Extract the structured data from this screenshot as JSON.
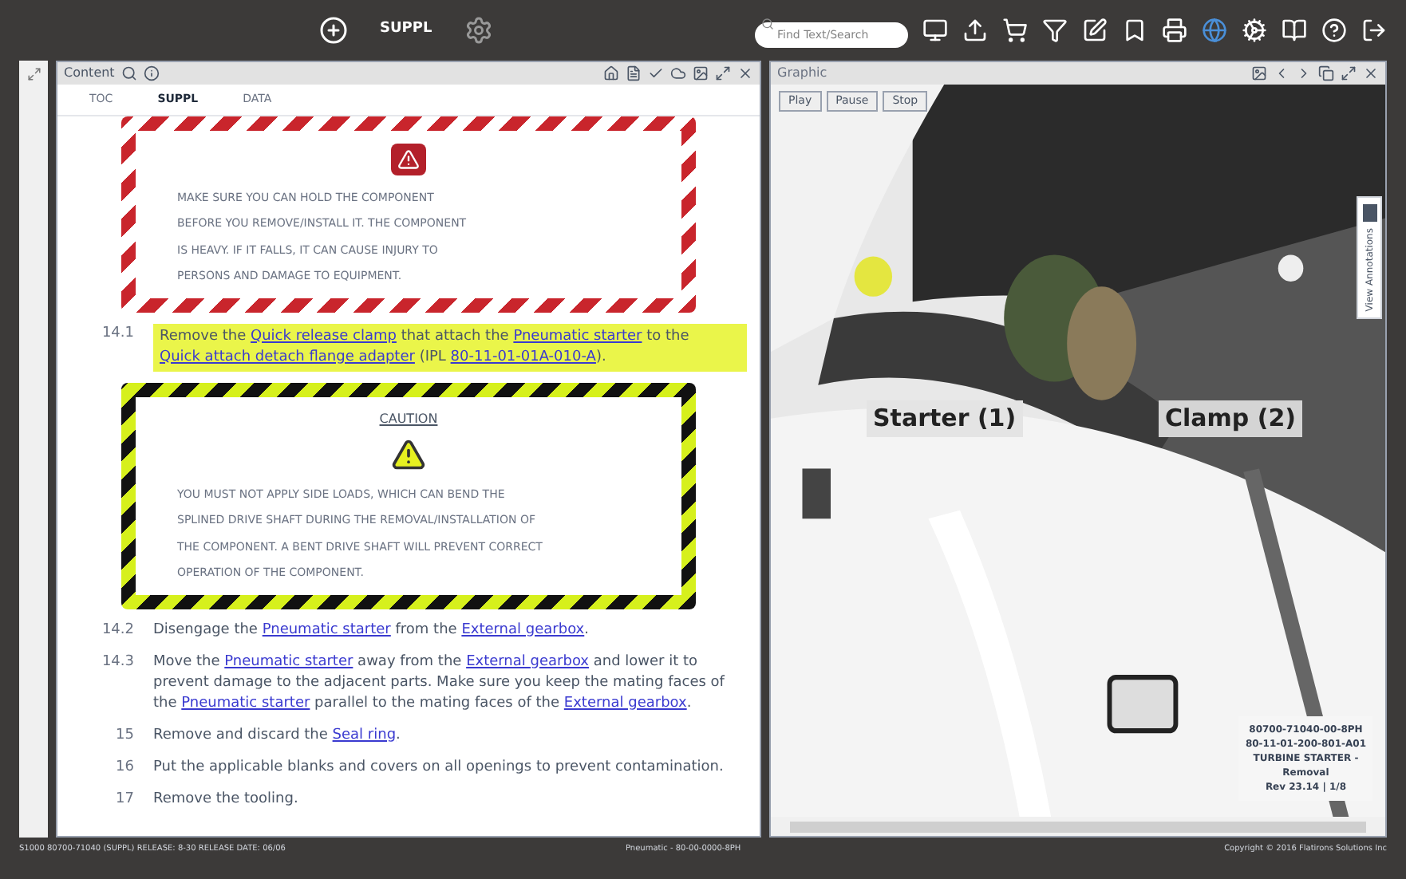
{
  "topbar": {
    "publication": "SUPPL",
    "search": {
      "placeholder": "Find Text/Search"
    }
  },
  "content_panel": {
    "title": "Content",
    "tabs": [
      {
        "label": "TOC",
        "selected": false
      },
      {
        "label": "SUPPL",
        "selected": true
      },
      {
        "label": "DATA",
        "selected": false
      }
    ],
    "warning": {
      "kind": "warning",
      "lines": [
        "MAKE SURE YOU CAN HOLD THE COMPONENT",
        "BEFORE YOU REMOVE/INSTALL IT. THE COMPONENT",
        "IS HEAVY. IF IT FALLS, IT CAN CAUSE INJURY TO",
        "PERSONS AND DAMAGE TO EQUIPMENT."
      ]
    },
    "step_14_1": {
      "number": "14.1",
      "highlighted": true,
      "parts": [
        {
          "text": "Remove the ",
          "link": false
        },
        {
          "text": "Quick release clamp",
          "link": true
        },
        {
          "text": " that attach the ",
          "link": false
        },
        {
          "text": "Pneumatic starter",
          "link": true
        },
        {
          "text": " to the ",
          "link": false
        },
        {
          "text": "Quick attach detach flange adapter",
          "link": true
        },
        {
          "text": " (IPL ",
          "link": false
        },
        {
          "text": "80-11-01-01A-010-A",
          "link": true
        },
        {
          "text": ").",
          "link": false
        }
      ]
    },
    "caution": {
      "kind": "caution",
      "title": "CAUTION",
      "lines": [
        "YOU MUST NOT APPLY SIDE LOADS, WHICH CAN BEND THE",
        "SPLINED DRIVE SHAFT DURING THE REMOVAL/INSTALLATION OF",
        "THE COMPONENT. A BENT DRIVE SHAFT WILL PREVENT CORRECT",
        "OPERATION OF THE COMPONENT."
      ]
    },
    "steps": [
      {
        "number": "14.2",
        "highlighted": false,
        "parts": [
          {
            "text": "Disengage the ",
            "link": false
          },
          {
            "text": "Pneumatic starter",
            "link": true
          },
          {
            "text": " from the ",
            "link": false
          },
          {
            "text": "External gearbox",
            "link": true
          },
          {
            "text": ".",
            "link": false
          }
        ]
      },
      {
        "number": "14.3",
        "highlighted": false,
        "parts": [
          {
            "text": "Move the ",
            "link": false
          },
          {
            "text": "Pneumatic starter",
            "link": true
          },
          {
            "text": " away from the ",
            "link": false
          },
          {
            "text": "External gearbox",
            "link": true
          },
          {
            "text": " and lower it to prevent damage to the adjacent parts. Make sure you keep the mating faces of the ",
            "link": false
          },
          {
            "text": "Pneumatic starter",
            "link": true
          },
          {
            "text": " parallel to the mating faces of the ",
            "link": false
          },
          {
            "text": "External gearbox",
            "link": true
          },
          {
            "text": ".",
            "link": false
          }
        ]
      },
      {
        "number": "15",
        "highlighted": false,
        "parts": [
          {
            "text": "Remove and discard the ",
            "link": false
          },
          {
            "text": "Seal ring",
            "link": true
          },
          {
            "text": ".",
            "link": false
          }
        ]
      },
      {
        "number": "16",
        "highlighted": false,
        "parts": [
          {
            "text": "Put the applicable blanks and covers on all openings to prevent contamination.",
            "link": false
          }
        ]
      },
      {
        "number": "17",
        "highlighted": false,
        "parts": [
          {
            "text": "Remove the tooling.",
            "link": false
          }
        ]
      }
    ]
  },
  "graphic_panel": {
    "title": "Graphic",
    "buttons": [
      "Play",
      "Pause",
      "Stop"
    ],
    "side_tab": "View Annotations",
    "callouts": [
      "Starter (1)",
      "Clamp (2)"
    ],
    "info_lines": [
      "80700-71040-00-8PH",
      "80-11-01-200-801-A01",
      "TURBINE STARTER -",
      "Removal",
      "Rev 23.14 | 1/8"
    ]
  },
  "status_bar": {
    "left": "S1000 80700-71040 (SUPPL) RELEASE: 8-30 RELEASE DATE: 06/06",
    "middle": "Pneumatic - 80-00-0000-8PH",
    "right": "Copyright © 2016 Flatirons Solutions Inc"
  }
}
